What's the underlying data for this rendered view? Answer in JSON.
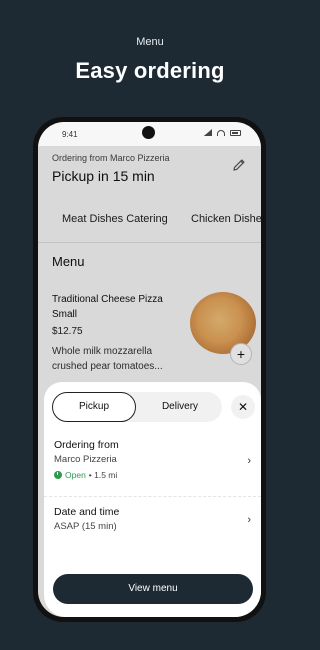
{
  "promo": {
    "subtitle": "Menu",
    "title": "Easy ordering"
  },
  "status_bar": {
    "time": "9:41"
  },
  "header": {
    "ordering_label": "Ordering from Marco Pizzeria",
    "pickup_time": "Pickup in 15 min",
    "edit_icon": "pencil-icon"
  },
  "tabs": [
    {
      "label": "Meat Dishes Catering",
      "active": true
    },
    {
      "label": "Chicken Dishes",
      "active": false
    }
  ],
  "menu": {
    "heading": "Menu",
    "item": {
      "name": "Traditional Cheese Pizza Small",
      "price": "$12.75",
      "description": "Whole milk mozzarella crushed pear tomatoes...",
      "add_label": "+"
    }
  },
  "sheet": {
    "options": [
      "Pickup",
      "Delivery"
    ],
    "selected": "Pickup",
    "close_label": "✕",
    "ordering_from": {
      "title": "Ordering from",
      "restaurant": "Marco Pizzeria",
      "status": "Open",
      "distance": "• 1.5 mi"
    },
    "date_time": {
      "title": "Date and time",
      "value": "ASAP (15 min)"
    },
    "chevron": "›",
    "cta": "View menu"
  },
  "colors": {
    "background": "#1d2a33",
    "open_green": "#2e9b4f",
    "cta": "#1d2a33"
  }
}
